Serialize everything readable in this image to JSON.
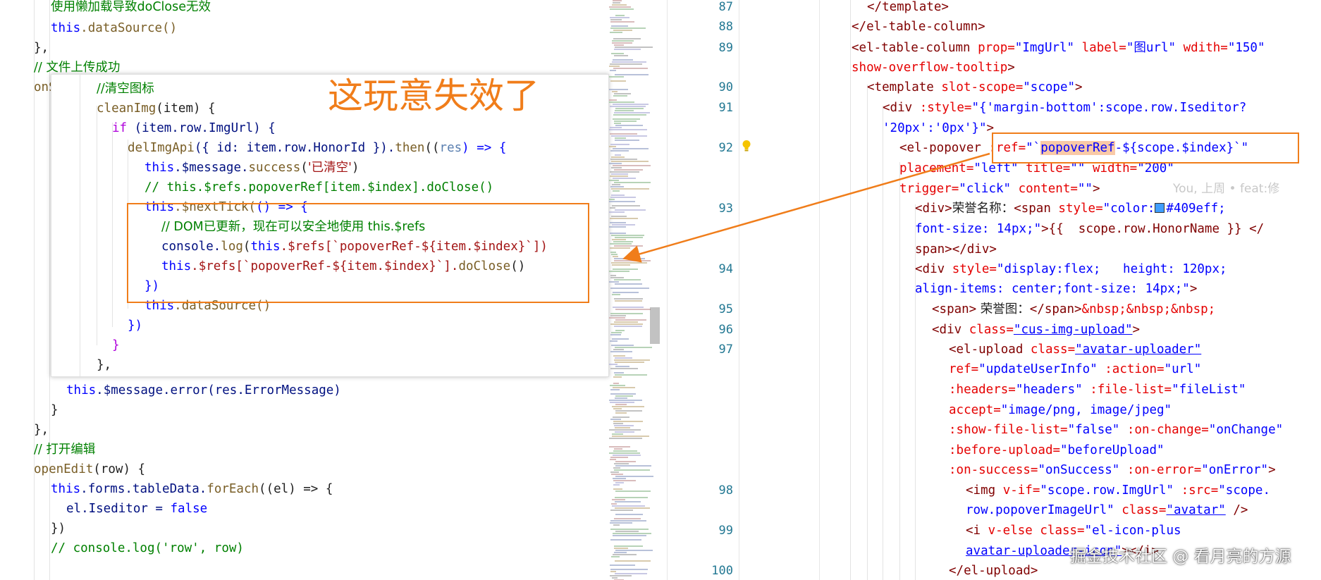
{
  "left": {
    "l1": "使用懒加载导致doClose无效",
    "l2a": "this",
    "l2b": ".dataSource()",
    "l3": "},",
    "l4": "// 文件上传成功",
    "l5": "onS",
    "err_a": "this",
    "err_b": ".$message.error(res.ErrorMessage)",
    "brace1": "}",
    "brace2": "},",
    "cm_edit": "// 打开编辑",
    "openEdit": "openEdit",
    "openEdit_args": "(row) {",
    "forEach_a": "this",
    "forEach_b": ".forms.tableData.",
    "forEach_fn": "forEach",
    "forEach_c": "((el) => {",
    "iseditor": "el.Iseditor = ",
    "iseditor_val": "false",
    "close_paren": "})",
    "cm_log": "// console.log('row', row)"
  },
  "popup": {
    "cm_clear": "//清空图标",
    "cleanImg": "cleanImg",
    "cleanImg_args": "(item) {",
    "if_kw": "if",
    "if_cond": " (item.row.ImgUrl) {",
    "del_fn": "delImgApi",
    "del_args": "({ id: item.row.HonorId }).",
    "then_fn": "then",
    "then_open": "((",
    "res": "res",
    "then_arrow": ") => {",
    "msg_a": "this",
    "msg_b": ".$message.",
    "msg_fn": "success",
    "msg_str": "'已清空'",
    "msg_close": ")",
    "cm_refs": "// this.$refs.popoverRef[item.$index].doClose()",
    "tick_a": "this",
    "tick_b": ".$nextTick(",
    "tick_c": "() => {",
    "cm_dom": "// DOM已更新，现在可以安全地使用 this.$refs",
    "log_a": "console.",
    "log_fn": "log",
    "log_b": "(",
    "log_c": "this",
    "log_d": ".$refs[`popoverRef-${item.$index}`])",
    "close_a": "this",
    "close_b": ".$refs[`popoverRef-${item.$index}`].",
    "close_fn": "doClose",
    "close_c": "()",
    "inner_close": "})",
    "ds_a": "this",
    "ds_b": ".dataSource()",
    "outer_close": "})",
    "brace": "}",
    "brace2": "},"
  },
  "annotation": "这玩意失效了",
  "line_numbers": [
    "87",
    "88",
    "89",
    "90",
    "91",
    "92",
    "93",
    "94",
    "95",
    "96",
    "97",
    "98",
    "99",
    "100"
  ],
  "right": {
    "r1": "</template>",
    "r2": "</el-table-column>",
    "r3_tag": "<el-table-column",
    "r3_a1": " prop=",
    "r3_v1": "\"ImgUrl\"",
    "r3_a2": " label=",
    "r3_v2": "\"图url\"",
    "r3_a3": " wdith=",
    "r3_v3": "\"150\"",
    "r4_a": "show-overflow-tooltip",
    "r4_b": ">",
    "r5_tag": "<template",
    "r5_a": " slot-scope=",
    "r5_v": "\"scope\"",
    "r5_c": ">",
    "r6_tag": "<div",
    "r6_a": " :style=",
    "r6_v": "\"{'margin-bottom':scope.row.Iseditor?",
    "r7_v": "'20px':'0px'}\"",
    "r7_c": ">",
    "r8_tag": "<el-popover",
    "r8_a": " :ref=",
    "r8_q": "\"`",
    "r8_hl": "popoverRef",
    "r8_rest": "-${scope.$index}`\"",
    "r9_a1": "placement=",
    "r9_v1": "\"left\"",
    "r9_a2": " title=",
    "r9_v2": "\"\"",
    "r9_a3": " width=",
    "r9_v3": "\"200\"",
    "r10_a1": "trigger=",
    "r10_v1": "\"click\"",
    "r10_a2": " content=",
    "r10_v2": "\"\"",
    "r10_c": ">",
    "blame": "You, 上周 • feat:修",
    "r11_tag": "<div>",
    "r11_t": "荣誉名称：",
    "r11_tag2": "<span",
    "r11_a": " style=",
    "r11_v1": "\"color:",
    "r11_v2": "#409eff;",
    "r12_v": "font-size: 14px;\"",
    "r12_b": ">{{  scope.row.HonorName }} </",
    "r13_tag": "span",
    "r13_b": "></",
    "r13_tag2": "div",
    "r13_c": ">",
    "r14_tag": "<div",
    "r14_a": " style=",
    "r14_v": "\"display:flex;   height: 120px;",
    "r15_v": "align-items: center;font-size: 14px;\"",
    "r15_c": ">",
    "r16_tag": "<span>",
    "r16_t": " 荣誉图：",
    "r16_tag2": "</span>",
    "r16_ent": "&nbsp;&nbsp;&nbsp;",
    "r17_tag": "<div",
    "r17_a": " class=",
    "r17_v": "\"cus-img-upload\"",
    "r17_c": ">",
    "r18_tag": "<el-upload",
    "r18_a": " class=",
    "r18_v": "\"avatar-uploader\"",
    "r19_a1": "ref=",
    "r19_v1": "\"updateUserInfo\"",
    "r19_a2": " :action=",
    "r19_v2": "\"url\"",
    "r20_a1": ":headers=",
    "r20_v1": "\"headers\"",
    "r20_a2": " :file-list=",
    "r20_v2": "\"fileList\"",
    "r21_a": "accept=",
    "r21_v": "\"image/png, image/jpeg\"",
    "r22_a1": ":show-file-list=",
    "r22_v1": "\"false\"",
    "r22_a2": " :on-change=",
    "r22_v2": "\"onChange\"",
    "r23_a": ":before-upload=",
    "r23_v": "\"beforeUpload\"",
    "r24_a1": ":on-success=",
    "r24_v1": "\"onSuccess\"",
    "r24_a2": " :on-error=",
    "r24_v2": "\"onError\"",
    "r24_c": ">",
    "r25_tag": "<img",
    "r25_a1": " v-if=",
    "r25_v1": "\"scope.row.ImgUrl\"",
    "r25_a2": " :src=",
    "r25_v2": "\"scope.",
    "r26_v": "row.popoverImageUrl\"",
    "r26_a": " class=",
    "r26_v2": "\"avatar\"",
    "r26_c": " />",
    "r27_tag": "<i",
    "r27_a1": " v-else",
    "r27_a2": " class=",
    "r27_v": "\"el-icon-plus",
    "r28_v": "avatar-uploader-icon\"",
    "r28_c": "></i>",
    "r29_tag": "</el-upload>"
  },
  "watermark": "掘金技术社区 @ 看月亮的方源",
  "colors": {
    "accent_orange": "#f07d1a",
    "swatch": "#409eff",
    "line_number": "#237893"
  },
  "icons": [
    "lightbulb-icon",
    "color-swatch-icon",
    "arrow-annotation"
  ]
}
